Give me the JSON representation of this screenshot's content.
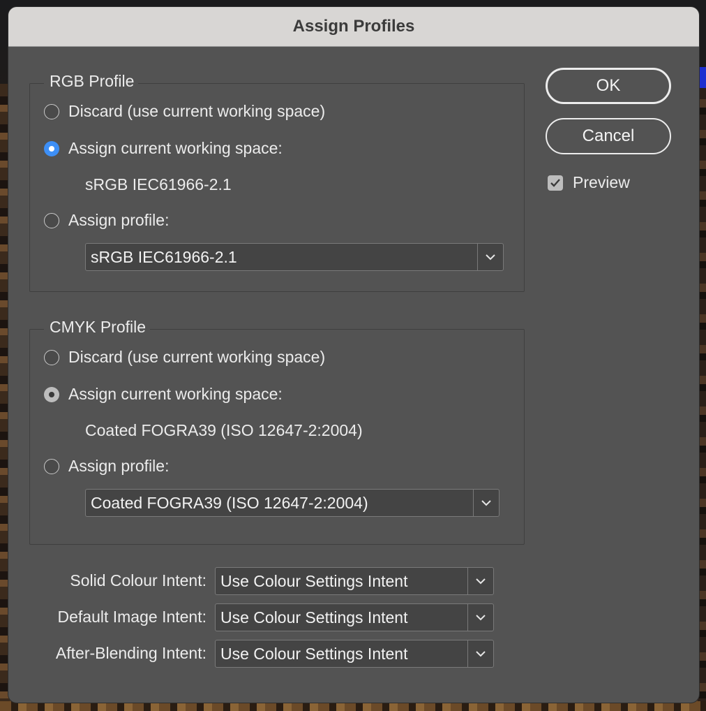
{
  "dialog": {
    "title": "Assign Profiles"
  },
  "rgb": {
    "group_label": "RGB Profile",
    "discard_label": "Discard (use current working space)",
    "assign_current_label": "Assign current working space:",
    "current_space": "sRGB IEC61966-2.1",
    "assign_profile_label": "Assign profile:",
    "profile_value": "sRGB IEC61966-2.1",
    "selected": "assign_current"
  },
  "cmyk": {
    "group_label": "CMYK Profile",
    "discard_label": "Discard (use current working space)",
    "assign_current_label": "Assign current working space:",
    "current_space": "Coated FOGRA39 (ISO 12647-2:2004)",
    "assign_profile_label": "Assign profile:",
    "profile_value": "Coated FOGRA39 (ISO 12647-2:2004)",
    "selected": "assign_current"
  },
  "intents": [
    {
      "label": "Solid Colour Intent:",
      "value": "Use Colour Settings Intent"
    },
    {
      "label": "Default Image Intent:",
      "value": "Use Colour Settings Intent"
    },
    {
      "label": "After-Blending Intent:",
      "value": "Use Colour Settings Intent"
    }
  ],
  "buttons": {
    "ok_label": "OK",
    "cancel_label": "Cancel"
  },
  "preview": {
    "label": "Preview",
    "checked": true
  },
  "colors": {
    "accent": "#3d8ff6",
    "dialog_bg": "#535353",
    "titlebar_bg": "#d8d6d4"
  }
}
